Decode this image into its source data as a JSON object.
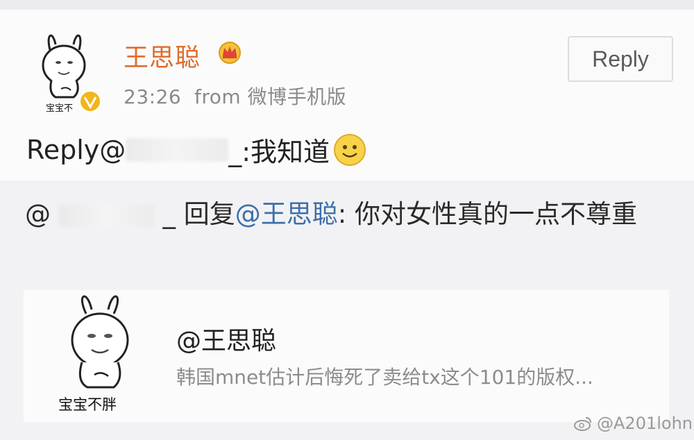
{
  "post": {
    "username": "王思聪",
    "timestamp": "23:26",
    "source": "from 微博手机版",
    "reply_button_label": "Reply",
    "avatar_caption": "宝宝不胖",
    "avatar_caption_visible": "宝宝不",
    "reply_prefix": "Reply@",
    "reply_suffix": "_:我知道",
    "verified_icon": "verified-badge-icon",
    "crown_icon": "crown-icon",
    "emoji_icon": "smile-emoji-icon"
  },
  "original_comment": {
    "prefix": "@",
    "suffix": "_ 回复",
    "mention": "@王思聪",
    "text": ": 你对女性真的一点不尊重"
  },
  "quote_card": {
    "title": "@王思聪",
    "description": "韩国mnet估计后悔死了卖给tx这个101的版权...",
    "avatar_caption": "宝宝不胖"
  },
  "watermark": {
    "text": "@A201lohn"
  },
  "colors": {
    "username": "#e06c2c",
    "mention": "#3e6fa8",
    "verified": "#f2b51a"
  }
}
